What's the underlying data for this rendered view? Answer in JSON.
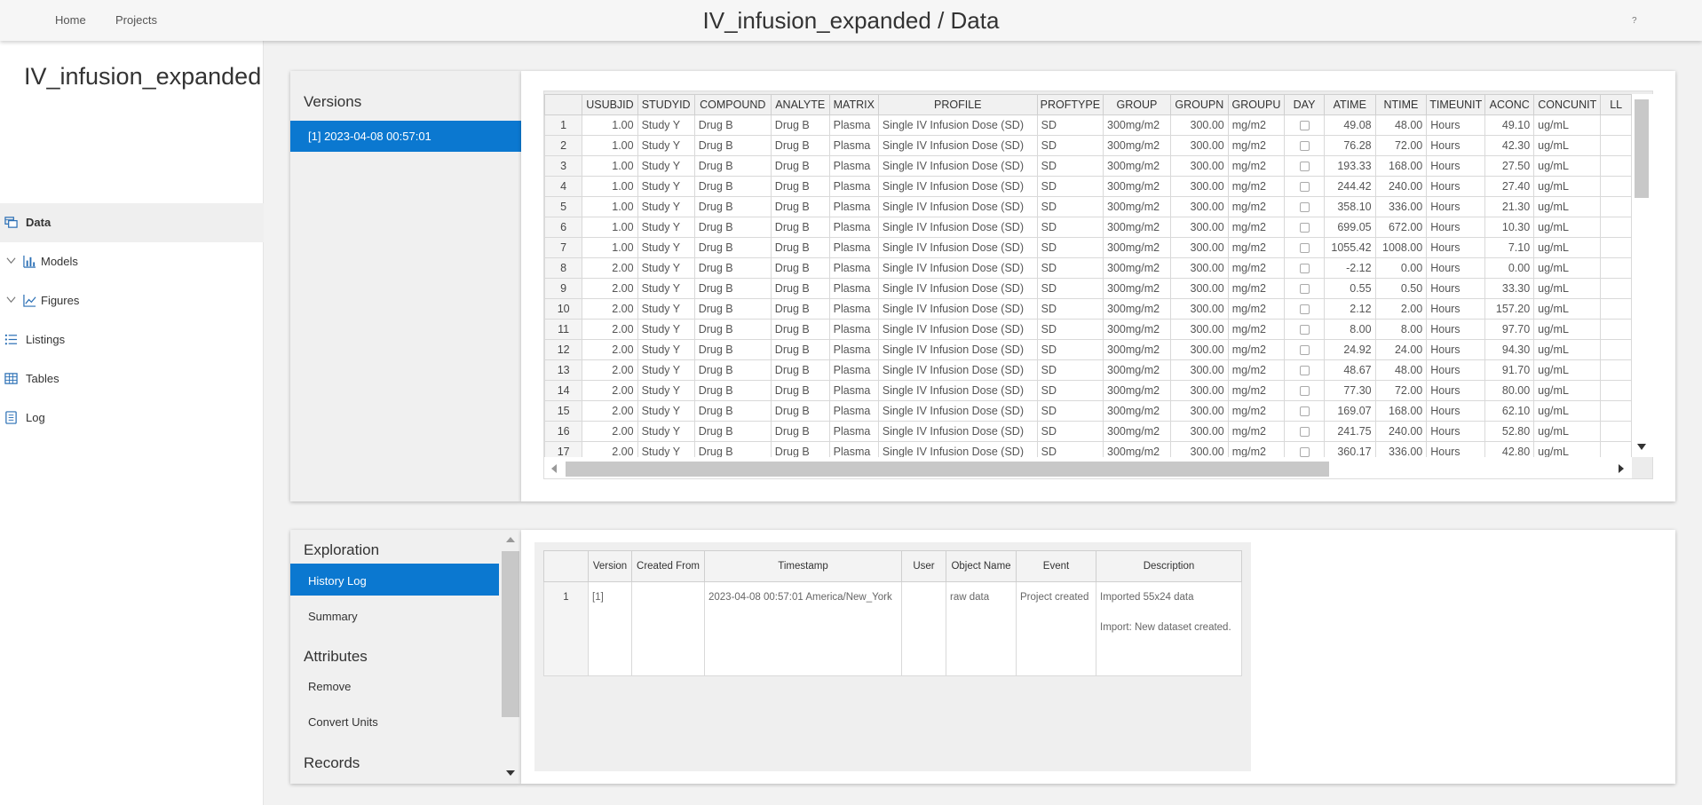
{
  "nav": {
    "home": "Home",
    "projects": "Projects",
    "help": "?"
  },
  "page": {
    "title": "IV_infusion_expanded / Data"
  },
  "sidebar": {
    "project_title": "IV_infusion_expanded",
    "items": [
      {
        "label": "Data",
        "icon": "data-icon",
        "active": true
      },
      {
        "label": "Models",
        "icon": "bar-chart-icon",
        "expandable": true
      },
      {
        "label": "Figures",
        "icon": "line-chart-icon",
        "expandable": true
      },
      {
        "label": "Listings",
        "icon": "list-icon"
      },
      {
        "label": "Tables",
        "icon": "table-icon"
      },
      {
        "label": "Log",
        "icon": "document-icon"
      }
    ]
  },
  "versions": {
    "heading": "Versions",
    "items": [
      "[1] 2023-04-08 00:57:01"
    ]
  },
  "data_grid": {
    "columns": [
      "USUBJID",
      "STUDYID",
      "COMPOUND",
      "ANALYTE",
      "MATRIX",
      "PROFILE",
      "PROFTYPE",
      "GROUP",
      "GROUPN",
      "GROUPU",
      "DAY",
      "ATIME",
      "NTIME",
      "TIMEUNIT",
      "ACONC",
      "CONCUNIT",
      "LL"
    ],
    "rows": [
      [
        "1",
        "1.00",
        "Study Y",
        "Drug B",
        "Drug B",
        "Plasma",
        "Single IV Infusion Dose (SD)",
        "SD",
        "300mg/m2",
        "300.00",
        "mg/m2",
        "",
        "49.08",
        "48.00",
        "Hours",
        "49.10",
        "ug/mL"
      ],
      [
        "2",
        "1.00",
        "Study Y",
        "Drug B",
        "Drug B",
        "Plasma",
        "Single IV Infusion Dose (SD)",
        "SD",
        "300mg/m2",
        "300.00",
        "mg/m2",
        "",
        "76.28",
        "72.00",
        "Hours",
        "42.30",
        "ug/mL"
      ],
      [
        "3",
        "1.00",
        "Study Y",
        "Drug B",
        "Drug B",
        "Plasma",
        "Single IV Infusion Dose (SD)",
        "SD",
        "300mg/m2",
        "300.00",
        "mg/m2",
        "",
        "193.33",
        "168.00",
        "Hours",
        "27.50",
        "ug/mL"
      ],
      [
        "4",
        "1.00",
        "Study Y",
        "Drug B",
        "Drug B",
        "Plasma",
        "Single IV Infusion Dose (SD)",
        "SD",
        "300mg/m2",
        "300.00",
        "mg/m2",
        "",
        "244.42",
        "240.00",
        "Hours",
        "27.40",
        "ug/mL"
      ],
      [
        "5",
        "1.00",
        "Study Y",
        "Drug B",
        "Drug B",
        "Plasma",
        "Single IV Infusion Dose (SD)",
        "SD",
        "300mg/m2",
        "300.00",
        "mg/m2",
        "",
        "358.10",
        "336.00",
        "Hours",
        "21.30",
        "ug/mL"
      ],
      [
        "6",
        "1.00",
        "Study Y",
        "Drug B",
        "Drug B",
        "Plasma",
        "Single IV Infusion Dose (SD)",
        "SD",
        "300mg/m2",
        "300.00",
        "mg/m2",
        "",
        "699.05",
        "672.00",
        "Hours",
        "10.30",
        "ug/mL"
      ],
      [
        "7",
        "1.00",
        "Study Y",
        "Drug B",
        "Drug B",
        "Plasma",
        "Single IV Infusion Dose (SD)",
        "SD",
        "300mg/m2",
        "300.00",
        "mg/m2",
        "",
        "1055.42",
        "1008.00",
        "Hours",
        "7.10",
        "ug/mL"
      ],
      [
        "8",
        "2.00",
        "Study Y",
        "Drug B",
        "Drug B",
        "Plasma",
        "Single IV Infusion Dose (SD)",
        "SD",
        "300mg/m2",
        "300.00",
        "mg/m2",
        "",
        "-2.12",
        "0.00",
        "Hours",
        "0.00",
        "ug/mL"
      ],
      [
        "9",
        "2.00",
        "Study Y",
        "Drug B",
        "Drug B",
        "Plasma",
        "Single IV Infusion Dose (SD)",
        "SD",
        "300mg/m2",
        "300.00",
        "mg/m2",
        "",
        "0.55",
        "0.50",
        "Hours",
        "33.30",
        "ug/mL"
      ],
      [
        "10",
        "2.00",
        "Study Y",
        "Drug B",
        "Drug B",
        "Plasma",
        "Single IV Infusion Dose (SD)",
        "SD",
        "300mg/m2",
        "300.00",
        "mg/m2",
        "",
        "2.12",
        "2.00",
        "Hours",
        "157.20",
        "ug/mL"
      ],
      [
        "11",
        "2.00",
        "Study Y",
        "Drug B",
        "Drug B",
        "Plasma",
        "Single IV Infusion Dose (SD)",
        "SD",
        "300mg/m2",
        "300.00",
        "mg/m2",
        "",
        "8.00",
        "8.00",
        "Hours",
        "97.70",
        "ug/mL"
      ],
      [
        "12",
        "2.00",
        "Study Y",
        "Drug B",
        "Drug B",
        "Plasma",
        "Single IV Infusion Dose (SD)",
        "SD",
        "300mg/m2",
        "300.00",
        "mg/m2",
        "",
        "24.92",
        "24.00",
        "Hours",
        "94.30",
        "ug/mL"
      ],
      [
        "13",
        "2.00",
        "Study Y",
        "Drug B",
        "Drug B",
        "Plasma",
        "Single IV Infusion Dose (SD)",
        "SD",
        "300mg/m2",
        "300.00",
        "mg/m2",
        "",
        "48.67",
        "48.00",
        "Hours",
        "91.70",
        "ug/mL"
      ],
      [
        "14",
        "2.00",
        "Study Y",
        "Drug B",
        "Drug B",
        "Plasma",
        "Single IV Infusion Dose (SD)",
        "SD",
        "300mg/m2",
        "300.00",
        "mg/m2",
        "",
        "77.30",
        "72.00",
        "Hours",
        "80.00",
        "ug/mL"
      ],
      [
        "15",
        "2.00",
        "Study Y",
        "Drug B",
        "Drug B",
        "Plasma",
        "Single IV Infusion Dose (SD)",
        "SD",
        "300mg/m2",
        "300.00",
        "mg/m2",
        "",
        "169.07",
        "168.00",
        "Hours",
        "62.10",
        "ug/mL"
      ],
      [
        "16",
        "2.00",
        "Study Y",
        "Drug B",
        "Drug B",
        "Plasma",
        "Single IV Infusion Dose (SD)",
        "SD",
        "300mg/m2",
        "300.00",
        "mg/m2",
        "",
        "241.75",
        "240.00",
        "Hours",
        "52.80",
        "ug/mL"
      ],
      [
        "17",
        "2.00",
        "Study Y",
        "Drug B",
        "Drug B",
        "Plasma",
        "Single IV Infusion Dose (SD)",
        "SD",
        "300mg/m2",
        "300.00",
        "mg/m2",
        "",
        "360.17",
        "336.00",
        "Hours",
        "42.80",
        "ug/mL"
      ]
    ]
  },
  "exploration": {
    "heading": "Exploration",
    "items": [
      {
        "label": "History Log",
        "selected": true
      },
      {
        "label": "Summary"
      }
    ],
    "attributes_heading": "Attributes",
    "attribute_items": [
      "Remove",
      "Convert Units"
    ],
    "records_heading": "Records"
  },
  "history": {
    "columns": [
      "Version",
      "Created From",
      "Timestamp",
      "User",
      "Object Name",
      "Event",
      "Description"
    ],
    "rows": [
      {
        "n": "1",
        "version": "[1]",
        "created_from": "",
        "timestamp": "2023-04-08 00:57:01 America/New_York",
        "user": "",
        "object_name": "raw data",
        "event": "Project created",
        "description": [
          "Imported 55x24 data",
          "Import: New dataset created."
        ]
      }
    ]
  },
  "colors": {
    "accent": "#0b78d0",
    "panel_bg": "#f0f0f0"
  }
}
